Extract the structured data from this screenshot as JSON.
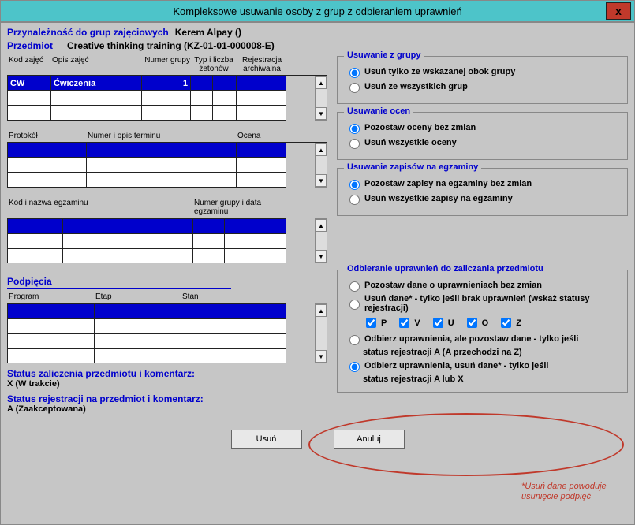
{
  "window": {
    "title": "Kompleksowe usuwanie osoby z grup z odbieraniem uprawnień",
    "close": "x"
  },
  "header": {
    "membership_label": "Przynależność do grup zajęciowych",
    "person_name": "Kerem Alpay ()",
    "subject_label": "Przedmiot",
    "subject_value": "Creative thinking training (KZ-01-01-000008-E)"
  },
  "groups_table": {
    "headers": {
      "kod": "Kod zajęć",
      "opis": "Opis zajęć",
      "numer": "Numer grupy",
      "typ": "Typ i liczba\nżetonów",
      "rejestracja": "Rejestracja\narchiwalna"
    },
    "rows": [
      {
        "kod": "CW",
        "opis": "Ćwiczenia",
        "numer": "1",
        "typ": "",
        "rej": ""
      }
    ]
  },
  "protokol_table": {
    "headers": {
      "protokol": "Protokół",
      "numer_termin": "Numer i opis terminu",
      "ocena": "Ocena"
    }
  },
  "egzamin_table": {
    "headers": {
      "kod_nazwa": "Kod i nazwa egzaminu",
      "numer_data": "Numer grupy i data egzaminu"
    }
  },
  "podpiecia": {
    "title": "Podpięcia",
    "headers": {
      "program": "Program",
      "etap": "Etap",
      "stan": "Stan"
    }
  },
  "status": {
    "zalicz_label": "Status zaliczenia przedmiotu i komentarz:",
    "zalicz_value": "X (W trakcie)",
    "rej_label": "Status rejestracji na przedmiot i komentarz:",
    "rej_value": "A (Zaakceptowana)"
  },
  "panel_usuwanie_grupy": {
    "title": "Usuwanie z grupy",
    "opt1": "Usuń tylko ze wskazanej obok grupy",
    "opt2": "Usuń ze wszystkich grup"
  },
  "panel_usuwanie_ocen": {
    "title": "Usuwanie ocen",
    "opt1": "Pozostaw oceny bez zmian",
    "opt2": "Usuń wszystkie oceny"
  },
  "panel_usuwanie_zapisow": {
    "title": "Usuwanie zapisów na egzaminy",
    "opt1": "Pozostaw zapisy na egzaminy bez zmian",
    "opt2": "Usuń wszystkie zapisy na egzaminy"
  },
  "panel_uprawnienia": {
    "title": "Odbieranie uprawnień do zaliczania przedmiotu",
    "opt1": "Pozostaw dane o uprawnieniach bez zmian",
    "opt2": "Usuń dane* - tylko jeśli brak uprawnień (wskaż statusy rejestracji)",
    "checks": {
      "P": "P",
      "V": "V",
      "U": "U",
      "O": "O",
      "Z": "Z"
    },
    "opt3a": "Odbierz uprawnienia, ale pozostaw dane - tylko jeśli",
    "opt3b": "status rejestracji A (A przechodzi na Z)",
    "opt4a": "Odbierz uprawnienia, usuń dane* - tylko jeśli",
    "opt4b": "status rejestracji A lub X"
  },
  "note": {
    "line1": "*Usuń dane powoduje",
    "line2": "usunięcie podpięć"
  },
  "buttons": {
    "delete": "Usuń",
    "cancel": "Anuluj"
  }
}
